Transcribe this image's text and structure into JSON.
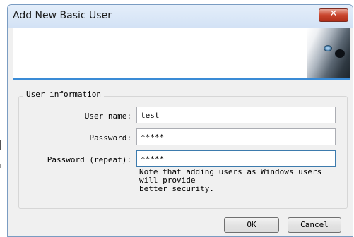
{
  "window": {
    "title": "Add New Basic User",
    "close_glyph": "✕"
  },
  "banner": {
    "image": "wolf-eye-logo"
  },
  "group": {
    "title": "User information"
  },
  "fields": {
    "username": {
      "label": "User name:",
      "value": "test"
    },
    "password": {
      "label": "Password:",
      "value": "*****"
    },
    "password_repeat": {
      "label": "Password (repeat):",
      "value": "*****"
    }
  },
  "note": "Note that adding users as Windows users\nwill provide\nbetter security.",
  "buttons": {
    "ok": "OK",
    "cancel": "Cancel"
  },
  "colors": {
    "accent_bar": "#3a8bd6",
    "close_button": "#c9452d",
    "titlebar": "#d9e6f6"
  }
}
